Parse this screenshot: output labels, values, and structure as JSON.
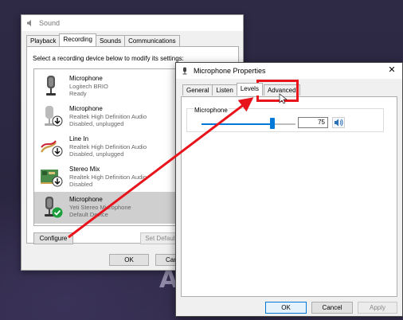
{
  "sound": {
    "title": "Sound",
    "tabs": [
      "Playback",
      "Recording",
      "Sounds",
      "Communications"
    ],
    "active_tab": "Recording",
    "instruction": "Select a recording device below to modify its settings:",
    "devices": [
      {
        "name": "Microphone",
        "desc": "Logitech BRIO",
        "status": "Ready",
        "icon": "microphone-icon"
      },
      {
        "name": "Microphone",
        "desc": "Realtek High Definition Audio",
        "status": "Disabled, unplugged",
        "icon": "microphone-disabled-icon"
      },
      {
        "name": "Line In",
        "desc": "Realtek High Definition Audio",
        "status": "Disabled, unplugged",
        "icon": "line-in-icon"
      },
      {
        "name": "Stereo Mix",
        "desc": "Realtek High Definition Audio",
        "status": "Disabled",
        "icon": "sound-card-icon"
      },
      {
        "name": "Microphone",
        "desc": "Yeti Stereo Microphone",
        "status": "Default Device",
        "icon": "microphone-default-icon"
      }
    ],
    "configure_label": "Configure",
    "set_default_label": "Set Default",
    "ok_label": "OK",
    "cancel_label": "Can"
  },
  "mic_props": {
    "title": "Microphone Properties",
    "tabs": [
      "General",
      "Listen",
      "Levels",
      "Advanced"
    ],
    "active_tab": "Levels",
    "level_label": "Microphone",
    "level_value": "75",
    "level_fraction": 0.75,
    "ok_label": "OK",
    "cancel_label": "Cancel",
    "apply_label": "Apply"
  },
  "wallpaper_text": "A",
  "colors": {
    "accent": "#0078d7",
    "annotation": "#e8141b",
    "selection": "#cfcfcf"
  }
}
